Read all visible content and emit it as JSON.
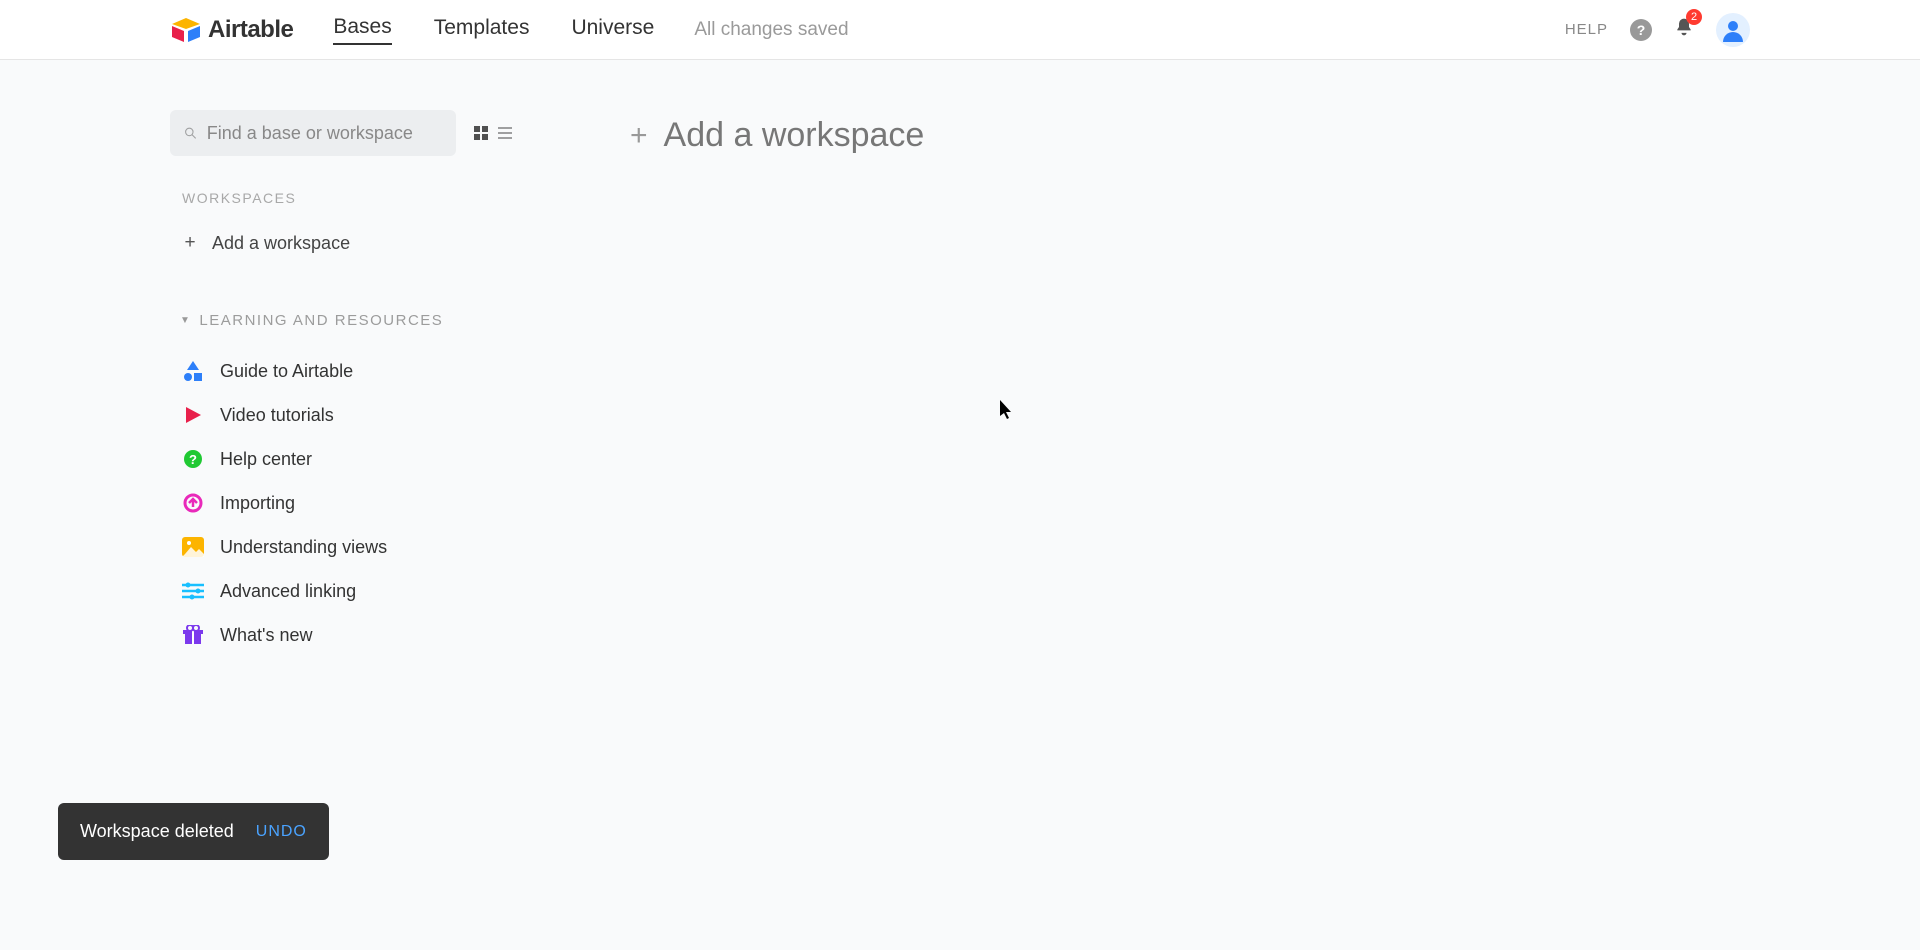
{
  "brand": {
    "name": "Airtable"
  },
  "nav": {
    "bases": "Bases",
    "templates": "Templates",
    "universe": "Universe"
  },
  "status": "All changes saved",
  "topbar": {
    "help_label": "HELP",
    "notification_count": "2"
  },
  "sidebar": {
    "search_placeholder": "Find a base or workspace",
    "workspaces_heading": "WORKSPACES",
    "add_workspace_label": "Add a workspace",
    "learning_heading": "LEARNING AND RESOURCES",
    "resources": {
      "guide": "Guide to Airtable",
      "video": "Video tutorials",
      "help": "Help center",
      "importing": "Importing",
      "views": "Understanding views",
      "linking": "Advanced linking",
      "new": "What's new"
    }
  },
  "content": {
    "add_workspace_main": "Add a workspace"
  },
  "toast": {
    "message": "Workspace deleted",
    "undo": "UNDO"
  }
}
